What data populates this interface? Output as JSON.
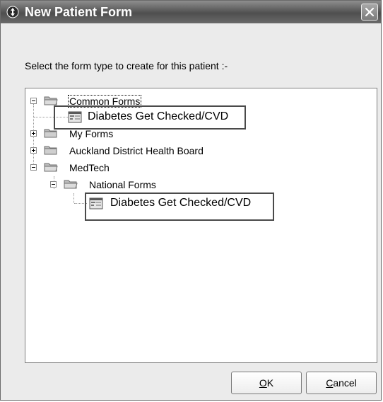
{
  "window": {
    "title": "New Patient Form",
    "close_symbol": "✕"
  },
  "instruction": "Select the form type to create for this patient :-",
  "tree": {
    "common_forms": "Common Forms",
    "common_child": "Diabetes Get Checked/CVD",
    "my_forms": "My Forms",
    "adhb": "Auckland District Health Board",
    "medtech": "MedTech",
    "national_forms": "National Forms",
    "national_child": "Diabetes Get Checked/CVD"
  },
  "buttons": {
    "ok_accel": "O",
    "ok_rest": "K",
    "cancel_accel": "C",
    "cancel_rest": "ancel"
  },
  "icons": {
    "title": "app-icon",
    "folder": "folder-icon",
    "form": "form-icon",
    "close": "close-icon"
  }
}
